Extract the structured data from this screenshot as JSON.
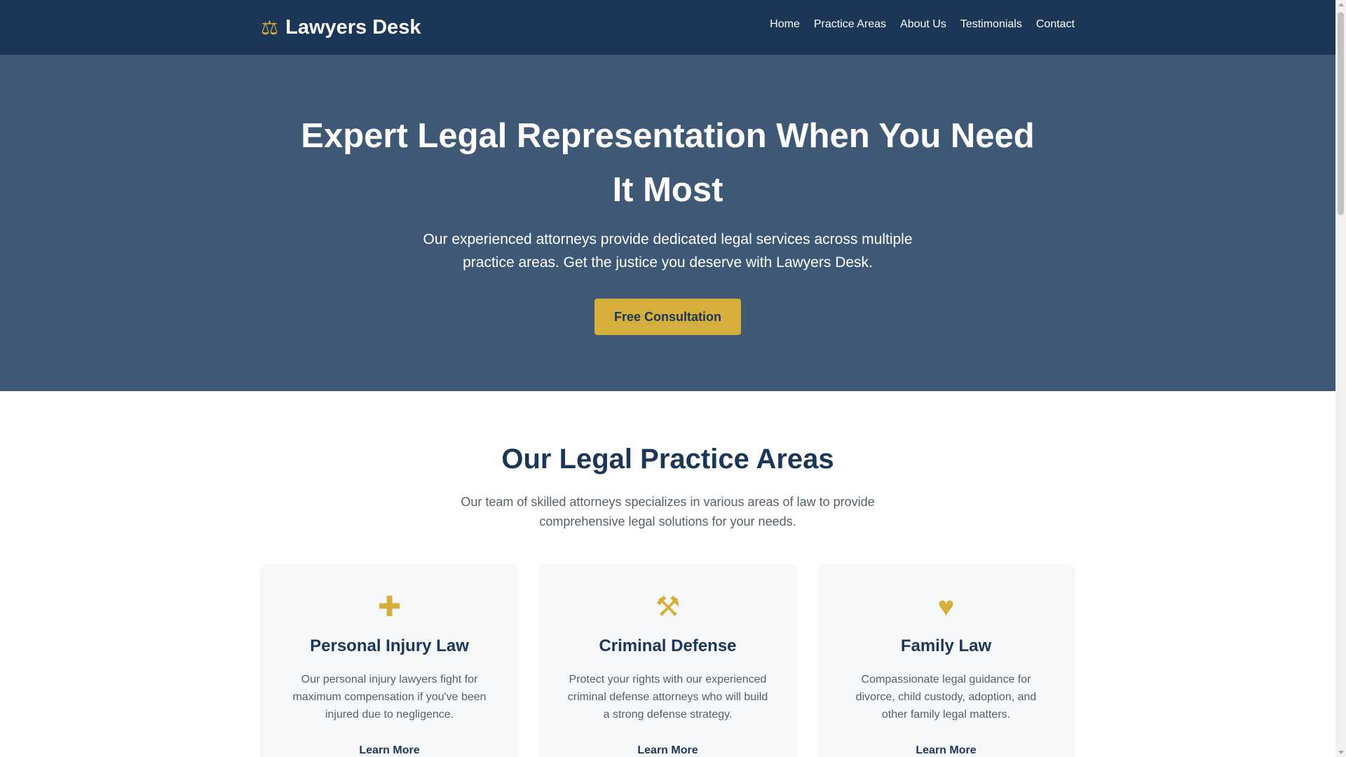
{
  "header": {
    "logo_icon": "balance-scale-icon",
    "logo_text": "Lawyers Desk",
    "nav": [
      "Home",
      "Practice Areas",
      "About Us",
      "Testimonials",
      "Contact"
    ]
  },
  "hero": {
    "title": "Expert Legal Representation When You Need It Most",
    "subtitle": "Our experienced attorneys provide dedicated legal services across multiple practice areas. Get the justice you deserve with Lawyers Desk.",
    "cta_label": "Free Consultation"
  },
  "practice": {
    "title": "Our Legal Practice Areas",
    "subtitle": "Our team of skilled attorneys specializes in various areas of law to provide comprehensive legal solutions for your needs.",
    "cards": [
      {
        "icon": "injury-icon",
        "title": "Personal Injury Law",
        "text": "Our personal injury lawyers fight for maximum compensation if you've been injured due to negligence.",
        "link": "Learn More"
      },
      {
        "icon": "gavel-icon",
        "title": "Criminal Defense",
        "text": "Protect your rights with our experienced criminal defense attorneys who will build a strong defense strategy.",
        "link": "Learn More"
      },
      {
        "icon": "family-icon",
        "title": "Family Law",
        "text": "Compassionate legal guidance for divorce, child custody, adoption, and other family legal matters.",
        "link": "Learn More"
      }
    ]
  },
  "colors": {
    "navy": "#1b3657",
    "hero_bg": "#3f5875",
    "gold": "#d6ae3b",
    "card_bg": "#f6f7f9",
    "muted_text": "#555f6a"
  }
}
